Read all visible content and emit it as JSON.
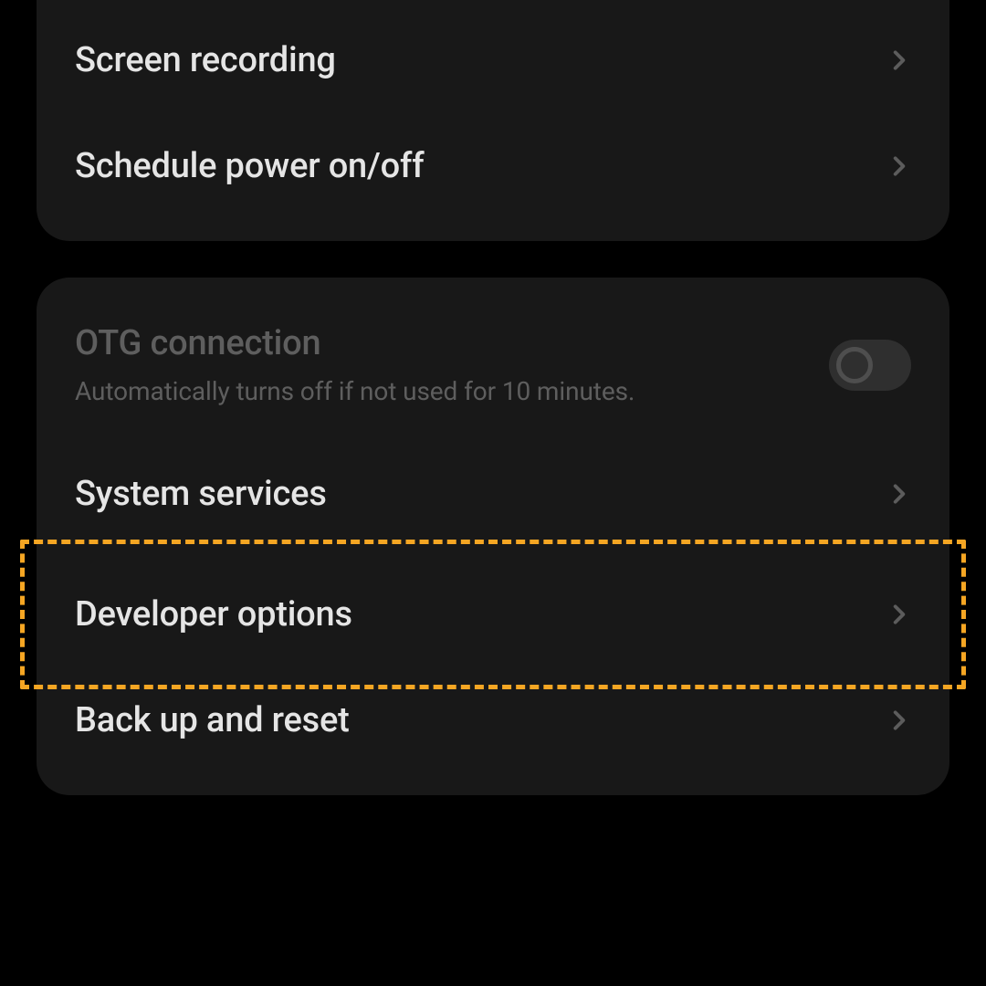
{
  "group1": {
    "screen_recording": "Screen recording",
    "schedule_power": "Schedule power on/off"
  },
  "group2": {
    "otg_title": "OTG connection",
    "otg_subtitle": "Automatically turns off if not used for 10 minutes.",
    "system_services": "System services",
    "developer_options": "Developer options",
    "backup_reset": "Back up and reset"
  }
}
